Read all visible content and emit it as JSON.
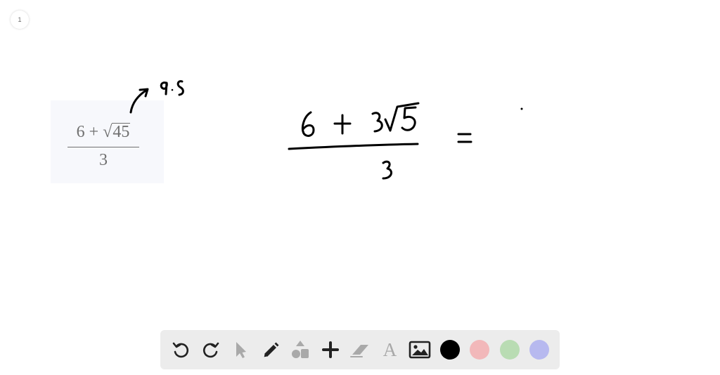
{
  "page": {
    "number": "1"
  },
  "problem": {
    "numerator_left": "6 + ",
    "sqrt_symbol": "√",
    "radicand": "45",
    "denominator": "3"
  },
  "toolbar": {
    "tools": [
      {
        "name": "undo",
        "icon": "undo-icon",
        "enabled": true
      },
      {
        "name": "redo",
        "icon": "redo-icon",
        "enabled": true
      },
      {
        "name": "select",
        "icon": "cursor-icon",
        "enabled": false
      },
      {
        "name": "pen",
        "icon": "pencil-icon",
        "enabled": true
      },
      {
        "name": "shapes",
        "icon": "shapes-icon",
        "enabled": false
      },
      {
        "name": "add",
        "icon": "plus-icon",
        "enabled": true
      },
      {
        "name": "eraser",
        "icon": "eraser-icon",
        "enabled": false
      },
      {
        "name": "text",
        "icon": "text-icon",
        "label": "A",
        "enabled": false
      },
      {
        "name": "image",
        "icon": "image-icon",
        "enabled": true
      }
    ],
    "colors": [
      "#000000",
      "#f2b8ba",
      "#b9dcb3",
      "#b7b9ef"
    ],
    "icon_color_enabled": "#222222",
    "icon_color_disabled": "#a9a9a9"
  }
}
